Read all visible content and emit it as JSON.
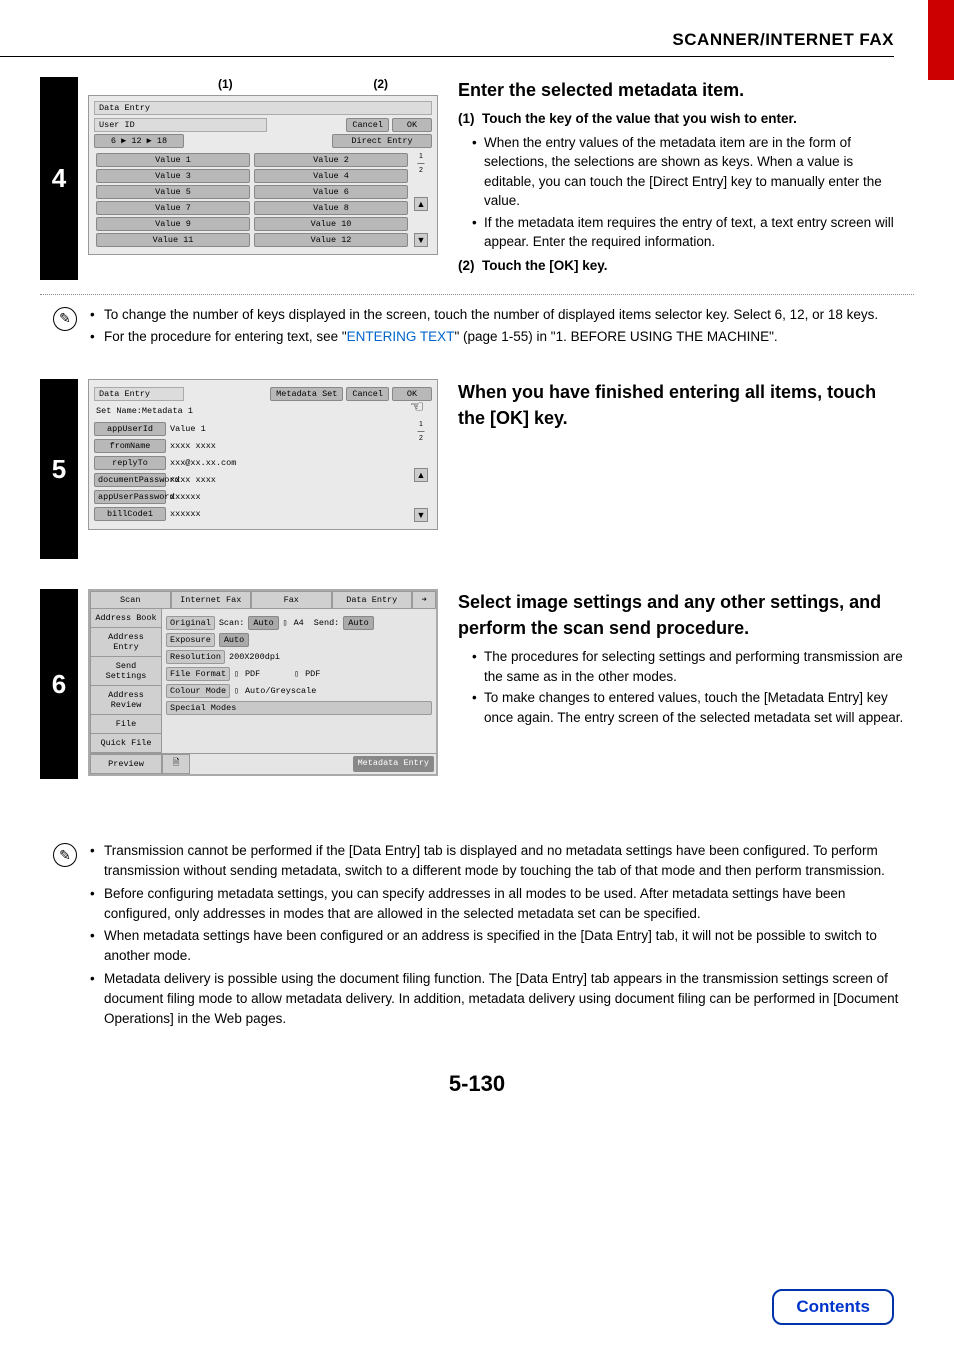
{
  "header": {
    "title": "SCANNER/INTERNET FAX"
  },
  "step4": {
    "num": "4",
    "callouts": {
      "c1": "(1)",
      "c2": "(2)"
    },
    "panel": {
      "title": "Data Entry",
      "label_userid": "User ID",
      "selector": "6 ▶ 12 ▶ 18",
      "cancel": "Cancel",
      "ok": "OK",
      "direct": "Direct Entry",
      "values_left": [
        "Value 1",
        "Value 3",
        "Value 5",
        "Value 7",
        "Value 9",
        "Value 11"
      ],
      "values_right": [
        "Value 2",
        "Value 4",
        "Value 6",
        "Value 8",
        "Value 10",
        "Value 12"
      ],
      "page_top": "1",
      "page_bot": "2"
    },
    "heading": "Enter the selected metadata item.",
    "sub1_label": "(1)",
    "sub1": "Touch the key of the value that you wish to enter.",
    "b1": "When the entry values of the metadata item are in the form of selections, the selections are shown as keys. When a value is editable, you can touch the [Direct Entry] key to manually enter the value.",
    "b2": "If the metadata item requires the entry of text, a text entry screen will appear. Enter the required information.",
    "sub2_label": "(2)",
    "sub2": "Touch the [OK] key."
  },
  "note4": {
    "b1a": "To change the number of keys displayed in the screen, touch the number of displayed items selector key. Select 6, 12, or 18 keys.",
    "b2a": "For the procedure for entering text, see \"",
    "b2link": "ENTERING TEXT",
    "b2b": "\" (page 1-55) in \"1. BEFORE USING THE MACHINE\"."
  },
  "step5": {
    "num": "5",
    "heading": "When you have finished entering all items, touch the [OK] key.",
    "panel": {
      "title": "Data Entry",
      "meta_set": "Metadata Set",
      "cancel": "Cancel",
      "ok": "OK",
      "setname": "Set Name:Metadata 1",
      "rows": [
        {
          "k": "appUserId",
          "v": "Value 1"
        },
        {
          "k": "fromName",
          "v": "xxxx xxxx"
        },
        {
          "k": "replyTo",
          "v": "xxx@xx.xx.com"
        },
        {
          "k": "documentPassword",
          "v": "xxxx xxxx"
        },
        {
          "k": "appUserPassword",
          "v": "xxxxxx"
        },
        {
          "k": "billCode1",
          "v": "xxxxxx"
        }
      ],
      "page_top": "1",
      "page_bot": "2"
    }
  },
  "step6": {
    "num": "6",
    "heading": "Select image settings and any other settings, and perform the scan send procedure.",
    "b1": "The procedures for selecting settings and performing transmission are the same as in the other modes.",
    "b2": "To make changes to entered values, touch the [Metadata Entry] key once again. The entry screen of the selected metadata set will appear.",
    "panel": {
      "tabs": [
        "Scan",
        "Internet Fax",
        "Fax",
        "Data Entry"
      ],
      "side": [
        "Address Book",
        "Address Entry",
        "Send Settings",
        "Address Review",
        "File",
        "Quick File",
        "Preview"
      ],
      "row_original": {
        "lbl": "Original",
        "t1": "Scan:",
        "p1": "Auto",
        "p2": "A4",
        "t2": "Send:",
        "p3": "Auto"
      },
      "row_exposure": {
        "lbl": "Exposure",
        "p": "Auto"
      },
      "row_res": {
        "lbl": "Resolution",
        "p": "200X200dpi"
      },
      "row_ff": {
        "lbl": "File Format",
        "p1": "PDF",
        "p2": "PDF"
      },
      "row_cm": {
        "lbl": "Colour Mode",
        "p": "Auto/Greyscale"
      },
      "row_sm": {
        "lbl": "Special Modes"
      },
      "meta_entry": "Metadata Entry"
    }
  },
  "bottom_notes": {
    "n1": "Transmission cannot be performed if the [Data Entry] tab is displayed and no metadata settings have been configured. To perform transmission without sending metadata, switch to a different mode by touching the tab of that mode and then perform transmission.",
    "n2": "Before configuring metadata settings, you can specify addresses in all modes to be used. After metadata settings have been configured, only addresses in modes that are allowed in the selected metadata set can be specified.",
    "n3": "When metadata settings have been configured or an address is specified in the [Data Entry] tab, it will not be possible to switch to another mode.",
    "n4": "Metadata delivery is possible using the document filing function. The [Data Entry] tab appears in the transmission settings screen of document filing mode to allow metadata delivery. In addition, metadata delivery using document filing can be performed in [Document Operations] in the Web pages."
  },
  "footer": {
    "page": "5-130",
    "contents": "Contents"
  }
}
